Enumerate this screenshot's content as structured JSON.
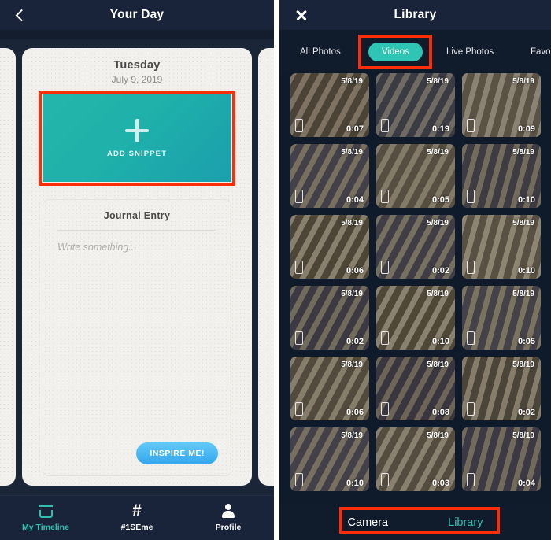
{
  "left_screen": {
    "navbar": {
      "back_icon": "chevron-left-icon",
      "title": "Your Day"
    },
    "card": {
      "day_name": "Tuesday",
      "date": "July 9, 2019",
      "snippet": {
        "icon": "plus-icon",
        "label": "ADD SNIPPET"
      },
      "journal": {
        "title": "Journal Entry",
        "placeholder": "Write something...",
        "inspire_label": "INSPIRE ME!"
      }
    },
    "tabbar": [
      {
        "icon": "calendar-icon",
        "label": "My Timeline",
        "active": true
      },
      {
        "icon": "hash-icon",
        "label": "#1SEme",
        "active": false
      },
      {
        "icon": "person-icon",
        "label": "Profile",
        "active": false
      }
    ]
  },
  "right_screen": {
    "navbar": {
      "close_icon": "close-x-icon",
      "title": "Library"
    },
    "filters": [
      {
        "label": "All Photos",
        "active": false
      },
      {
        "label": "Videos",
        "active": true
      },
      {
        "label": "Live Photos",
        "active": false
      },
      {
        "label": "Favori",
        "active": false
      }
    ],
    "grid": [
      {
        "date": "5/8/19",
        "duration": "0:07"
      },
      {
        "date": "5/8/19",
        "duration": "0:19"
      },
      {
        "date": "5/8/19",
        "duration": "0:09"
      },
      {
        "date": "5/8/19",
        "duration": "0:04"
      },
      {
        "date": "5/8/19",
        "duration": "0:05"
      },
      {
        "date": "5/8/19",
        "duration": "0:10"
      },
      {
        "date": "5/8/19",
        "duration": "0:06"
      },
      {
        "date": "5/8/19",
        "duration": "0:02"
      },
      {
        "date": "5/8/19",
        "duration": "0:10"
      },
      {
        "date": "5/8/19",
        "duration": "0:02"
      },
      {
        "date": "5/8/19",
        "duration": "0:10"
      },
      {
        "date": "5/8/19",
        "duration": "0:05"
      },
      {
        "date": "5/8/19",
        "duration": "0:06"
      },
      {
        "date": "5/8/19",
        "duration": "0:08"
      },
      {
        "date": "5/8/19",
        "duration": "0:02"
      },
      {
        "date": "5/8/19",
        "duration": "0:10"
      },
      {
        "date": "5/8/19",
        "duration": "0:03"
      },
      {
        "date": "5/8/19",
        "duration": "0:04"
      }
    ],
    "source_bar": [
      {
        "label": "Camera",
        "active": false
      },
      {
        "label": "Library",
        "active": true
      }
    ]
  },
  "colors": {
    "teal": "#2FC0B0",
    "snippet_teal": "#1FB1AA",
    "highlight_red": "#FB2E09",
    "nav_dark": "#19233A",
    "card_cream": "#F1F0EC",
    "inspire_blue": "#34A6EF"
  }
}
